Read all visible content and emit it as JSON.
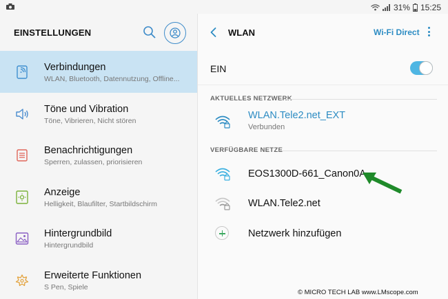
{
  "status_bar": {
    "battery": "31%",
    "time": "15:25"
  },
  "left": {
    "title": "EINSTELLUNGEN",
    "items": [
      {
        "title": "Verbindungen",
        "subtitle": "WLAN, Bluetooth, Datennutzung, Offline...",
        "icon": "connections-icon",
        "active": true
      },
      {
        "title": "Töne und Vibration",
        "subtitle": "Töne, Vibrieren, Nicht stören",
        "icon": "sound-icon"
      },
      {
        "title": "Benachrichtigungen",
        "subtitle": "Sperren, zulassen, priorisieren",
        "icon": "notifications-icon"
      },
      {
        "title": "Anzeige",
        "subtitle": "Helligkeit, Blaufilter, Startbildschirm",
        "icon": "display-icon"
      },
      {
        "title": "Hintergrundbild",
        "subtitle": "Hintergrundbild",
        "icon": "wallpaper-icon"
      },
      {
        "title": "Erweiterte Funktionen",
        "subtitle": "S Pen, Spiele",
        "icon": "advanced-features-icon"
      }
    ]
  },
  "right": {
    "title": "WLAN",
    "wifi_direct": "Wi-Fi Direct",
    "toggle_label": "EIN",
    "toggle_on": true,
    "current_section": "AKTUELLES NETZWERK",
    "current_network": {
      "name": "WLAN.Tele2.net_EXT",
      "status": "Verbunden"
    },
    "available_section": "VERFÜGBARE NETZE",
    "networks": [
      {
        "name": "EOS1300D-661_Canon0A",
        "signal": "strong"
      },
      {
        "name": "WLAN.Tele2.net",
        "signal": "weak"
      }
    ],
    "add_network": "Netzwerk hinzufügen"
  },
  "colors": {
    "accent": "#2d8cc3",
    "active_row": "#c9e3f3",
    "arrow": "#1f8a2a"
  },
  "watermark": "© MICRO TECH LAB www.LMscope.com"
}
